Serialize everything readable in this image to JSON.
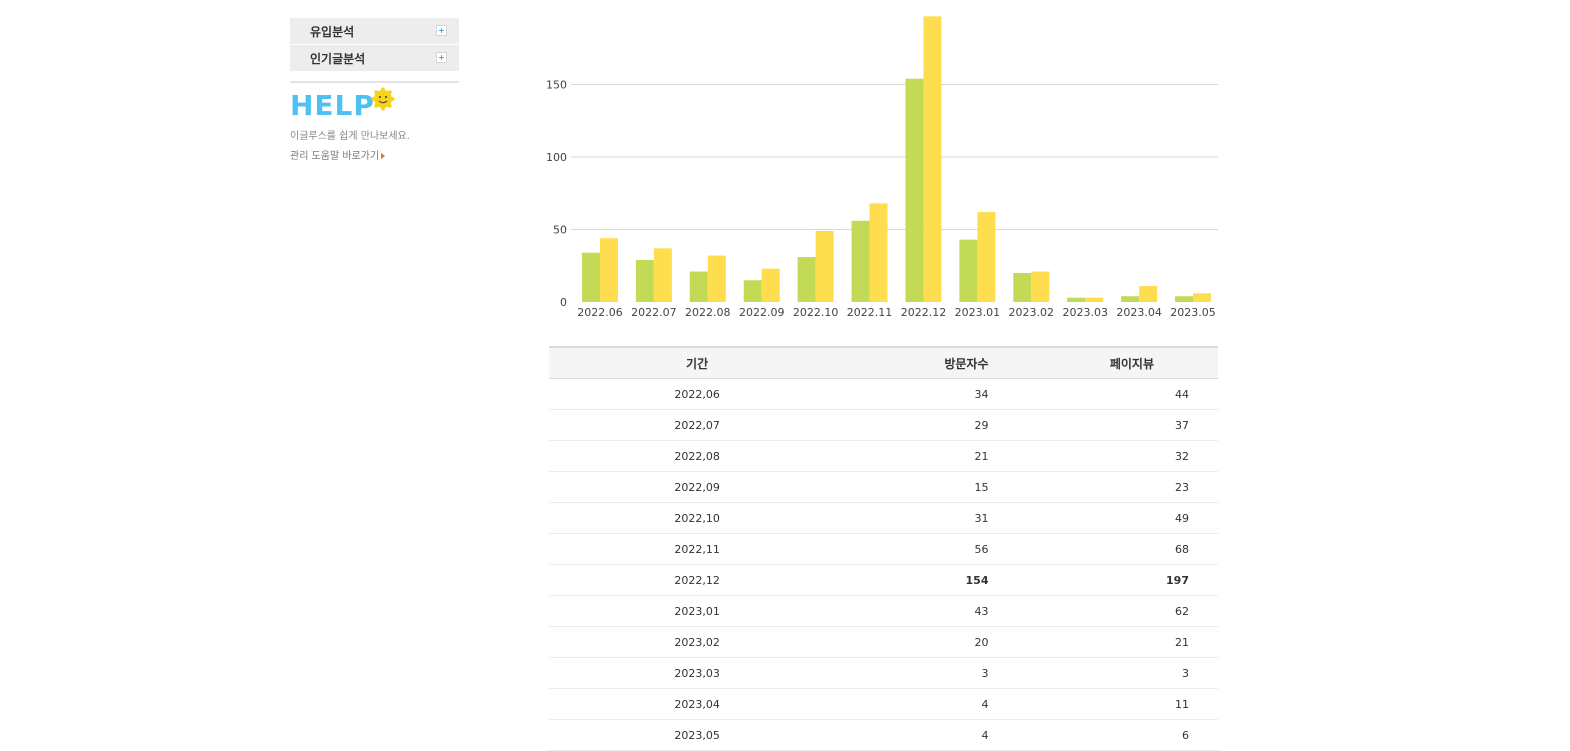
{
  "sidebar": {
    "menu": [
      {
        "label": "유입분석"
      },
      {
        "label": "인기글분석"
      }
    ],
    "help": {
      "logo_text": "HELP",
      "description": "이글루스를 쉽게 만나보세요.",
      "link_text": "관리 도움말 바로가기"
    }
  },
  "colors": {
    "visitors": "#c3da56",
    "pageviews": "#fedd4f",
    "grid": "#d9d9d9",
    "highlight": "#3c8cc8"
  },
  "chart_data": {
    "type": "bar",
    "categories": [
      "2022.06",
      "2022.07",
      "2022.08",
      "2022.09",
      "2022.10",
      "2022.11",
      "2022.12",
      "2023.01",
      "2023.02",
      "2023.03",
      "2023.04",
      "2023.05"
    ],
    "series": [
      {
        "values": [
          34,
          29,
          21,
          15,
          31,
          56,
          154,
          43,
          20,
          3,
          4,
          4
        ],
        "color": "#c3da56"
      },
      {
        "values": [
          44,
          37,
          32,
          23,
          49,
          68,
          197,
          62,
          21,
          3,
          11,
          6
        ],
        "color": "#fedd4f"
      }
    ],
    "yticks": [
      0,
      50,
      100,
      150
    ],
    "ylim": [
      0,
      197
    ],
    "grid": true,
    "title": "",
    "xlabel": "",
    "ylabel": ""
  },
  "table": {
    "headers": {
      "period": "기간",
      "visitors": "방문자수",
      "pageviews": "페이지뷰"
    },
    "rows": [
      {
        "period": "2022,06",
        "visitors": "34",
        "pageviews": "44"
      },
      {
        "period": "2022,07",
        "visitors": "29",
        "pageviews": "37"
      },
      {
        "period": "2022,08",
        "visitors": "21",
        "pageviews": "32"
      },
      {
        "period": "2022,09",
        "visitors": "15",
        "pageviews": "23"
      },
      {
        "period": "2022,10",
        "visitors": "31",
        "pageviews": "49"
      },
      {
        "period": "2022,11",
        "visitors": "56",
        "pageviews": "68"
      },
      {
        "period": "2022,12",
        "visitors": "154",
        "pageviews": "197",
        "highlight": true
      },
      {
        "period": "2023,01",
        "visitors": "43",
        "pageviews": "62"
      },
      {
        "period": "2023,02",
        "visitors": "20",
        "pageviews": "21"
      },
      {
        "period": "2023,03",
        "visitors": "3",
        "pageviews": "3"
      },
      {
        "period": "2023,04",
        "visitors": "4",
        "pageviews": "11"
      },
      {
        "period": "2023,05",
        "visitors": "4",
        "pageviews": "6"
      }
    ]
  }
}
